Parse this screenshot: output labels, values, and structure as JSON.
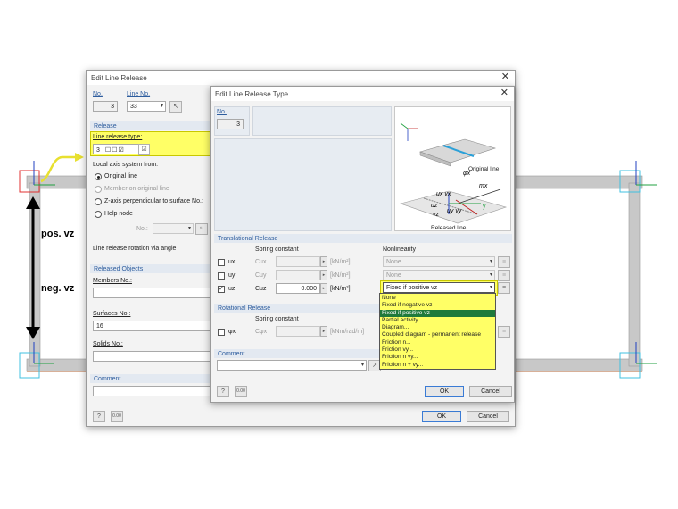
{
  "background": {
    "pos_label": "pos. vz",
    "neg_label": "neg. vz"
  },
  "main_dialog": {
    "title": "Edit Line Release",
    "no_label": "No.",
    "no_value": "3",
    "line_no_label": "Line No.",
    "line_no_value": "33",
    "release_header": "Release",
    "line_release_type_label": "Line release type:",
    "line_release_type_value": "3",
    "local_axis_label": "Local axis system from:",
    "axis_options": [
      "Original line",
      "Member on original line",
      "Z-axis perpendicular to surface No.:",
      "Help node"
    ],
    "help_node_no_label": "No.:",
    "rotation_label": "Line release rotation via angle",
    "released_objects_header": "Released Objects",
    "members_label": "Members No.:",
    "members_value": "",
    "surfaces_label": "Surfaces No.:",
    "surfaces_value": "16",
    "solids_label": "Solids No.:",
    "solids_value": "",
    "comment_header": "Comment",
    "ok_label": "OK",
    "cancel_label": "Cancel"
  },
  "type_dialog": {
    "title": "Edit Line Release Type",
    "no_label": "No.",
    "no_value": "3",
    "translational_header": "Translational Release",
    "spring_constant_label": "Spring constant",
    "nonlinearity_label": "Nonlinearity",
    "rows": [
      {
        "dof": "ux",
        "const": "Cux",
        "value": "",
        "unit": "[kN/m²]",
        "nonlin": "None",
        "checked": false
      },
      {
        "dof": "uy",
        "const": "Cuy",
        "value": "",
        "unit": "[kN/m²]",
        "nonlin": "None",
        "checked": false
      },
      {
        "dof": "uz",
        "const": "Cuz",
        "value": "0.000",
        "unit": "[kN/m²]",
        "nonlin": "Fixed if positive vz",
        "checked": true
      }
    ],
    "rotational_header": "Rotational Release",
    "rot_spring_label": "Spring constant",
    "rot_row": {
      "dof": "φx",
      "const": "Cφx",
      "unit": "[kNm/rad/m]"
    },
    "comment_header": "Comment",
    "ok_label": "OK",
    "cancel_label": "Cancel",
    "image_labels": {
      "original_line": "Original line",
      "released_line": "Released line"
    },
    "dropdown_options": [
      "None",
      "Fixed if negative vz",
      "Fixed if positive vz",
      "Partial activity...",
      "Diagram...",
      "Coupled diagram - permanent release",
      "Friction n...",
      "Friction vy...",
      "Friction n vy...",
      "Friction n + vy..."
    ],
    "dropdown_selected_index": 2
  },
  "colors": {
    "highlight": "#ffff66",
    "highlight_border": "#c8c800",
    "selected": "#1f7a3b",
    "section_text": "#2e5d9e",
    "frame_gray": "#c8c8c8"
  }
}
